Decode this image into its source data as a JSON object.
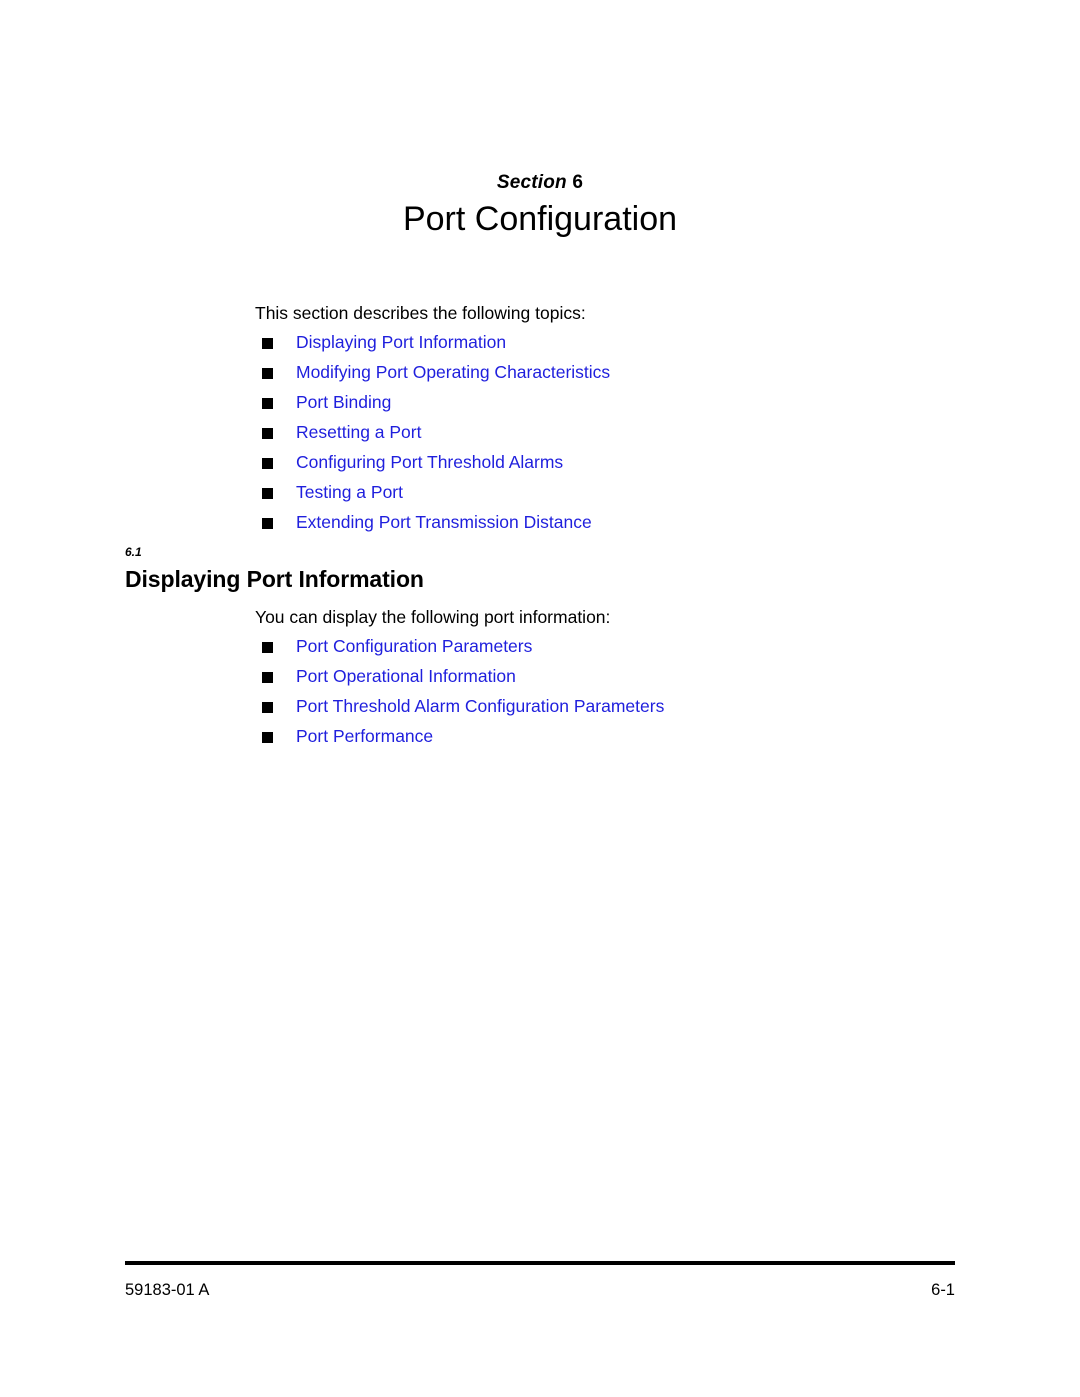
{
  "section": {
    "label_word": "Section",
    "label_number": "6",
    "title": "Port Configuration"
  },
  "intro": {
    "paragraph_1": "This section describes the following topics:",
    "paragraph_2": "You can display the following port information:"
  },
  "topics_list": [
    {
      "label": "Displaying Port Information"
    },
    {
      "label": "Modifying Port Operating Characteristics"
    },
    {
      "label": "Port Binding"
    },
    {
      "label": "Resetting a Port"
    },
    {
      "label": "Configuring Port Threshold Alarms"
    },
    {
      "label": "Testing a Port"
    },
    {
      "label": "Extending Port Transmission Distance"
    }
  ],
  "port_info_list": [
    {
      "label": "Port Configuration Parameters"
    },
    {
      "label": "Port Operational Information"
    },
    {
      "label": "Port Threshold Alarm Configuration Parameters"
    },
    {
      "label": "Port Performance"
    }
  ],
  "subsection": {
    "number": "6.1",
    "title": "Displaying Port Information"
  },
  "footer": {
    "document_number": "59183-01 A",
    "page_number": "6-1"
  },
  "colors": {
    "link": "#1f1fdd",
    "text": "#000000",
    "background": "#ffffff"
  }
}
